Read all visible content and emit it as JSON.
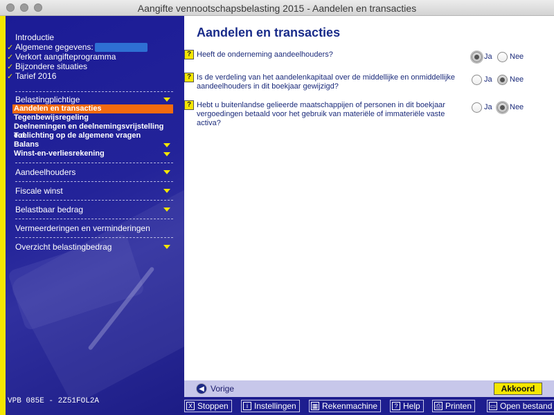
{
  "window": {
    "title": "Aangifte vennootschapsbelasting 2015 - Aandelen en transacties"
  },
  "sidebar": {
    "intro_items": [
      {
        "label": "Introductie",
        "checked": false
      },
      {
        "label": "Algemene gegevens:",
        "checked": true
      },
      {
        "label": "Verkort aangifteprogramma",
        "checked": true
      },
      {
        "label": "Bijzondere situaties",
        "checked": true
      },
      {
        "label": "Tarief 2016",
        "checked": true
      }
    ],
    "check_glyph": "✓",
    "section1_title": "Belastingplichtige",
    "section1_items": [
      {
        "label": "Aandelen en transacties",
        "active": true
      },
      {
        "label": "Tegenbewijsregeling"
      },
      {
        "label": "Deelnemingen en deelnemingsvrijstelling e.d."
      },
      {
        "label": "Toelichting op de algemene vragen"
      },
      {
        "label": "Balans"
      },
      {
        "label": "Winst-en-verliesrekening"
      }
    ],
    "sections": [
      "Aandeelhouders",
      "Fiscale winst",
      "Belastbaar bedrag",
      "Vermeerderingen en verminderingen",
      "Overzicht belastingbedrag"
    ],
    "version": "VPB 085E - 2Z51FOL2A"
  },
  "main": {
    "title": "Aandelen en transacties",
    "help_glyph": "?",
    "questions": [
      {
        "text": "Heeft de onderneming aandeelhouders?",
        "selected": "Ja"
      },
      {
        "text": "Is de verdeling van het aandelenkapitaal over de middellijke en onmiddellijke aandeelhouders in dit boekjaar gewijzigd?",
        "selected": "Nee"
      },
      {
        "text": "Hebt u buitenlandse gelieerde maatschappijen of personen in dit boekjaar vergoedingen betaald voor het gebruik van materiële of immateriële vaste activa?",
        "selected": "Nee"
      }
    ],
    "option_yes": "Ja",
    "option_no": "Nee"
  },
  "navigation": {
    "prev_label": "Vorige",
    "prev_glyph": "◀",
    "ok_label": "Akkoord"
  },
  "toolbar": {
    "stop": {
      "label": "Stoppen",
      "glyph": "X"
    },
    "settings": {
      "label": "Instellingen",
      "glyph": "i"
    },
    "calculator": {
      "label": "Rekenmachine",
      "glyph": "▦"
    },
    "help": {
      "label": "Help",
      "glyph": "?"
    },
    "print": {
      "label": "Printen",
      "glyph": "⎙"
    },
    "open": {
      "label": "Open bestand",
      "glyph": "▭"
    }
  },
  "colors": {
    "sidebar": "#1b1b96",
    "accent": "#f4e600",
    "active": "#f36b0f",
    "title": "#1a2c8a"
  }
}
